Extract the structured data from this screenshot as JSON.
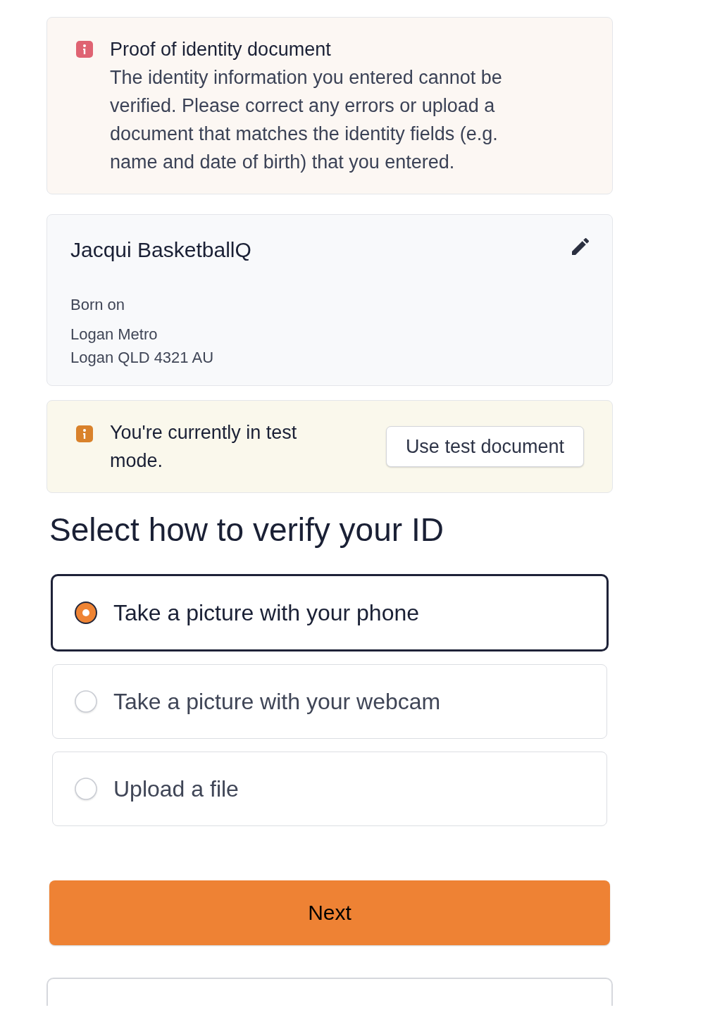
{
  "error_alert": {
    "title": "Proof of identity document",
    "message": "The identity information you entered cannot be verified. Please correct any errors or upload a document that matches the identity fields (e.g. name and date of birth) that you entered."
  },
  "identity_card": {
    "name": "Jacqui BasketballQ",
    "born_label": "Born on",
    "address_lines": [
      "Logan Metro",
      "Logan QLD 4321 AU"
    ]
  },
  "test_mode_alert": {
    "message": "You're currently in test mode.",
    "button": "Use test document"
  },
  "verify_section": {
    "heading": "Select how to verify your ID",
    "options": [
      {
        "label": "Take a picture with your phone",
        "selected": true
      },
      {
        "label": "Take a picture with your webcam",
        "selected": false
      },
      {
        "label": "Upload a file",
        "selected": false
      }
    ]
  },
  "actions": [
    {
      "kind": "primary",
      "label": "Next"
    },
    {
      "kind": "secondary"
    }
  ]
}
